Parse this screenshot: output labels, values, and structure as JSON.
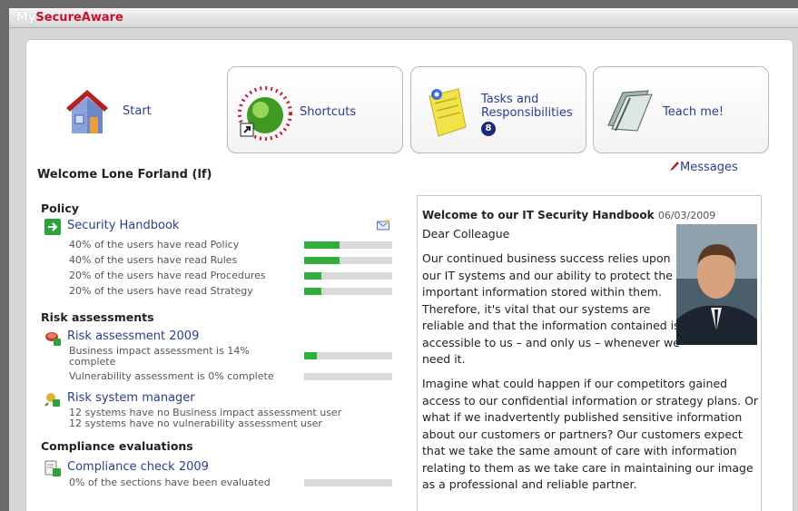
{
  "app": {
    "title_prefix": "My",
    "title_suffix": "SecureAware"
  },
  "nav": {
    "start": {
      "label": "Start",
      "icon": "house-icon"
    },
    "shortcuts": {
      "label": "Shortcuts",
      "icon": "globe-shortcut-icon"
    },
    "tasks": {
      "label_line1": "Tasks and",
      "label_line2": "Responsibilities",
      "badge": "8",
      "icon": "notepad-icon"
    },
    "teach": {
      "label": "Teach me!",
      "icon": "book-icon"
    }
  },
  "welcome": "Welcome Lone Forland (lf)",
  "messages_label": "Messages",
  "policy": {
    "heading": "Policy",
    "link": "Security Handbook",
    "stats": [
      {
        "text": "40% of the users have read Policy",
        "value": 0.4
      },
      {
        "text": "40% of the users have read Rules",
        "value": 0.4
      },
      {
        "text": "20% of the users have read Procedures",
        "value": 0.2
      },
      {
        "text": "20% of the users have read Strategy",
        "value": 0.2
      }
    ]
  },
  "risk": {
    "heading": "Risk assessments",
    "link": "Risk assessment 2009",
    "stat1_line1": "Business impact assessment is 14%",
    "stat1_line2": "complete",
    "stat1_value": 0.14,
    "stat2": "Vulnerability assessment is 0% complete",
    "stat2_value": 0,
    "manager_link": "Risk system manager",
    "manager_line1": "12 systems have no Business impact assessment user",
    "manager_line2": "12 systems have no vulnerability assessment user"
  },
  "compliance": {
    "heading": "Compliance evaluations",
    "link": "Compliance check 2009",
    "stat": "0% of the sections have been evaluated",
    "value": 0
  },
  "article": {
    "title": "Welcome to our IT Security Handbook",
    "date": "06/03/2009",
    "greeting": "Dear Colleague",
    "p1": "Our continued business success relies upon our IT systems and our ability to protect the important information stored within them. Therefore, it's vital that our systems are reliable and that the information contained is accessible to us – and only us – whenever we need it.",
    "p2": "Imagine what could happen if our competitors gained access to our confidential information or strategy plans. Or what if we inadvertently published sensitive information about our customers or partners? Our customers expect that we take the same amount of care with information relating to them as we take care in maintaining our image as a professional and reliable partner."
  },
  "colors": {
    "link": "#2b3e8c",
    "brand": "#c8102e",
    "progress": "#2fae3c",
    "track": "#d9d9d9"
  }
}
